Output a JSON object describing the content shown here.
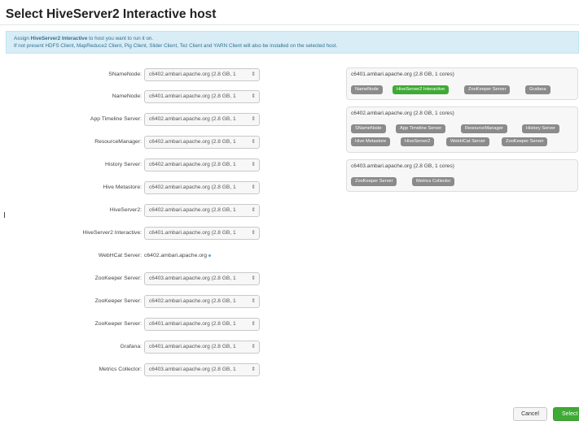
{
  "dialog": {
    "title": "Select HiveServer2 Interactive host",
    "info": {
      "line1_prefix": "Assign ",
      "line1_bold": "HiveServer2 Interactive",
      "line1_suffix": " to host you want to run it on.",
      "line2": "If not present HDFS Client, MapReduce2 Client, Pig Client, Slider Client, Tez Client and YARN Client will also be installed on the selected host."
    }
  },
  "assignments": [
    {
      "label": "SNameNode:",
      "value": "c6402.ambari.apache.org (2.8 GB, 1"
    },
    {
      "label": "NameNode:",
      "value": "c6401.ambari.apache.org (2.8 GB, 1"
    },
    {
      "label": "App Timeline Server:",
      "value": "c6402.ambari.apache.org (2.8 GB, 1"
    },
    {
      "label": "ResourceManager:",
      "value": "c6402.ambari.apache.org (2.8 GB, 1"
    },
    {
      "label": "History Server:",
      "value": "c6402.ambari.apache.org (2.8 GB, 1"
    },
    {
      "label": "Hive Metastore:",
      "value": "c6402.ambari.apache.org (2.8 GB, 1"
    },
    {
      "label": "HiveServer2:",
      "value": "c6402.ambari.apache.org (2.8 GB, 1"
    },
    {
      "label": "HiveServer2 Interactive:",
      "value": "c6401.ambari.apache.org (2.8 GB, 1"
    },
    {
      "label": "WebHCat Server:",
      "value": "c6402.ambari.apache.org"
    },
    {
      "label": "ZooKeeper Server:",
      "value": "c6403.ambari.apache.org (2.8 GB, 1"
    },
    {
      "label": "ZooKeeper Server:",
      "value": "c6402.ambari.apache.org (2.8 GB, 1"
    },
    {
      "label": "ZooKeeper Server:",
      "value": "c6401.ambari.apache.org (2.8 GB, 1"
    },
    {
      "label": "Grafana:",
      "value": "c6401.ambari.apache.org (2.8 GB, 1"
    },
    {
      "label": "Metrics Collector:",
      "value": "c6403.ambari.apache.org (2.8 GB, 1"
    }
  ],
  "select_arrow": "⇕",
  "hosts": [
    {
      "name": "c6401.ambari.apache.org (2.8 GB, 1 cores)",
      "components": [
        "NameNode",
        "HiveServer2 Interactive",
        "ZooKeeper Server",
        "Grafana"
      ]
    },
    {
      "name": "c6402.ambari.apache.org (2.8 GB, 1 cores)",
      "components": [
        "SNameNode",
        "App Timeline Server",
        "ResourceManager",
        "History Server",
        "Hive Metastore",
        "HiveServer2",
        "WebHCat Server",
        "ZooKeeper Server"
      ]
    },
    {
      "name": "c6403.ambari.apache.org (2.8 GB, 1 cores)",
      "components": [
        "ZooKeeper Server",
        "Metrics Collector"
      ]
    }
  ],
  "buttons": {
    "cancel": "Cancel",
    "select": "Select"
  },
  "colors": {
    "active_component": "#3faa35",
    "component": "#8b8b8b",
    "info_bg": "#d9edf7"
  }
}
